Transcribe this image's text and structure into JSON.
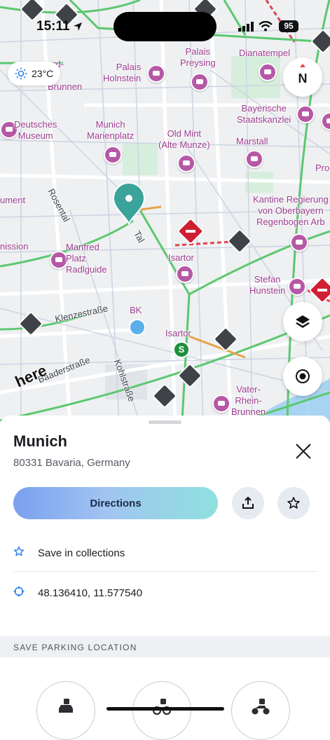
{
  "status": {
    "time": "15:11",
    "battery": "95"
  },
  "weather": {
    "temp": "23°C"
  },
  "compass": {
    "label": "N"
  },
  "map": {
    "brand": "here",
    "labels": [
      "ard-\nss-\nBrunnen",
      "Palais\nHolnstein",
      "Palais\nPreysing",
      "Dianatempel",
      "Deutsches\nMuseum",
      "Munich\nMarienplatz",
      "Old Mint\n(Alte Munze)",
      "Bayerische\nStaatskanzlei",
      "Marstall",
      "Pro",
      "Kantine Regierung\nvon Oberbayern\nRegenbogen Arb",
      "ument",
      "nission",
      "Manfred\nPlatz\nRadlguide",
      "Isartor",
      "Stefan\nHunstein",
      "BK",
      "Isartor",
      "Vater-\nRhein-\nBrunnen"
    ],
    "streets": [
      "Rosental",
      "Tal",
      "Klenzestraße",
      "Baaderstraße",
      "Kohlstraße"
    ]
  },
  "place": {
    "name": "Munich",
    "address": "80331 Bavaria, Germany",
    "directions_label": "Directions",
    "save_label": "Save in collections",
    "coordinates": "48.136410, 11.577540"
  },
  "parking": {
    "section_title": "SAVE PARKING LOCATION"
  },
  "colors": {
    "accent": "#2f80ed",
    "pin": "#3aa39a",
    "traffic_green": "#5bc86f",
    "traffic_red": "#e0444e",
    "water": "#a7d4f2"
  }
}
